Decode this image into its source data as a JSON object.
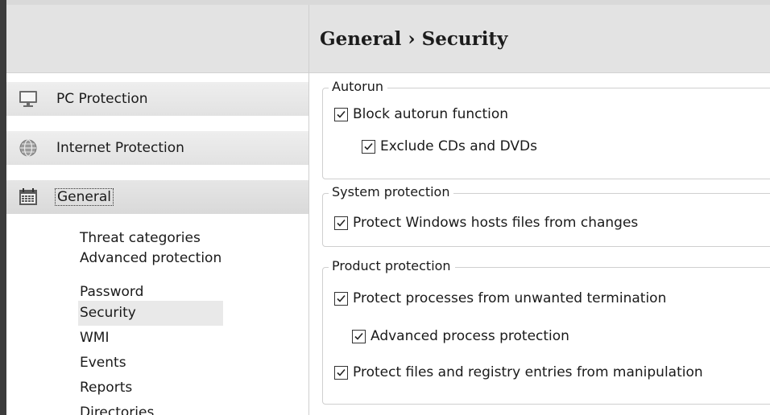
{
  "header": {
    "title": "General › Security"
  },
  "sidebar": {
    "items": [
      {
        "label": "PC Protection"
      },
      {
        "label": "Internet Protection"
      },
      {
        "label": "General"
      }
    ],
    "subitems": [
      "Threat categories",
      "Advanced protection",
      "Password",
      "Security",
      "WMI",
      "Events",
      "Reports",
      "Directories"
    ],
    "active_subitem": "Security"
  },
  "groups": {
    "autorun": {
      "legend": "Autorun",
      "block_autorun": {
        "label": "Block autorun function",
        "checked": true
      },
      "exclude_cds": {
        "label": "Exclude CDs and DVDs",
        "checked": true
      }
    },
    "system": {
      "legend": "System protection",
      "hosts": {
        "label": "Protect Windows hosts files from changes",
        "checked": true
      }
    },
    "product": {
      "legend": "Product protection",
      "processes": {
        "label": "Protect processes from unwanted termination",
        "checked": true
      },
      "advanced": {
        "label": "Advanced process protection",
        "checked": true
      },
      "files": {
        "label": "Protect files and registry entries from manipulation",
        "checked": true
      }
    }
  },
  "colors": {
    "header_bg": "#e3e3e3",
    "sidebar_item_bg": "#e9e9e9",
    "text": "#1a1a1a"
  }
}
